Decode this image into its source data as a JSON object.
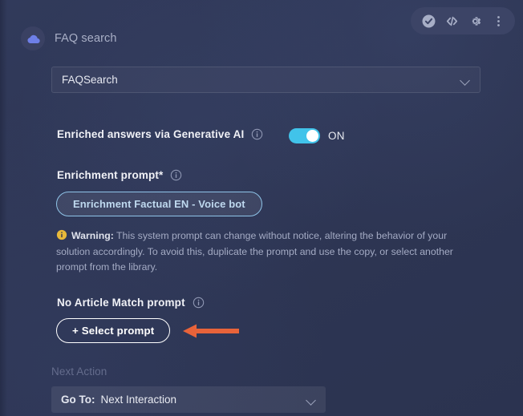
{
  "toolbar": {
    "items": [
      {
        "name": "validate-icon",
        "label": "Validate"
      },
      {
        "name": "code-icon",
        "label": "Code"
      },
      {
        "name": "gear-icon",
        "label": "Settings"
      },
      {
        "name": "more-vert-icon",
        "label": "More options"
      }
    ]
  },
  "header": {
    "icon": "cloud-icon",
    "title": "FAQ search"
  },
  "node_select": {
    "value": "FAQSearch",
    "chevron": "chevron-down-icon"
  },
  "enriched": {
    "label": "Enriched answers via Generative AI",
    "info": "info-icon",
    "toggle_state": "ON",
    "toggle_on": true
  },
  "enrichment_prompt": {
    "label": "Enrichment prompt*",
    "info": "info-icon",
    "chip_value": "Enrichment Factual EN - Voice bot"
  },
  "warning": {
    "icon": "warning-icon",
    "strong": "Warning:",
    "text": "This system prompt can change without notice, altering the behavior of your solution accordingly. To avoid this, duplicate the prompt and use the copy, or select another prompt from the library."
  },
  "no_article_match": {
    "label": "No Article Match prompt",
    "info": "info-icon",
    "button_label": "+ Select prompt"
  },
  "annotation": {
    "name": "arrow-annotation",
    "direction": "left",
    "color": "#E8633A"
  },
  "next_action": {
    "label": "Next Action",
    "goto_lead": "Go To:",
    "goto_value": "Next Interaction",
    "chevron": "chevron-down-icon"
  },
  "colors": {
    "background": "#2E3654",
    "accent_toggle": "#41C3EA",
    "chip_border": "#8FC4E8",
    "warning": "#E8B93A",
    "arrow": "#E8633A",
    "toolbar_bg": "#3C4466",
    "cloud": "#6E7FE8"
  }
}
